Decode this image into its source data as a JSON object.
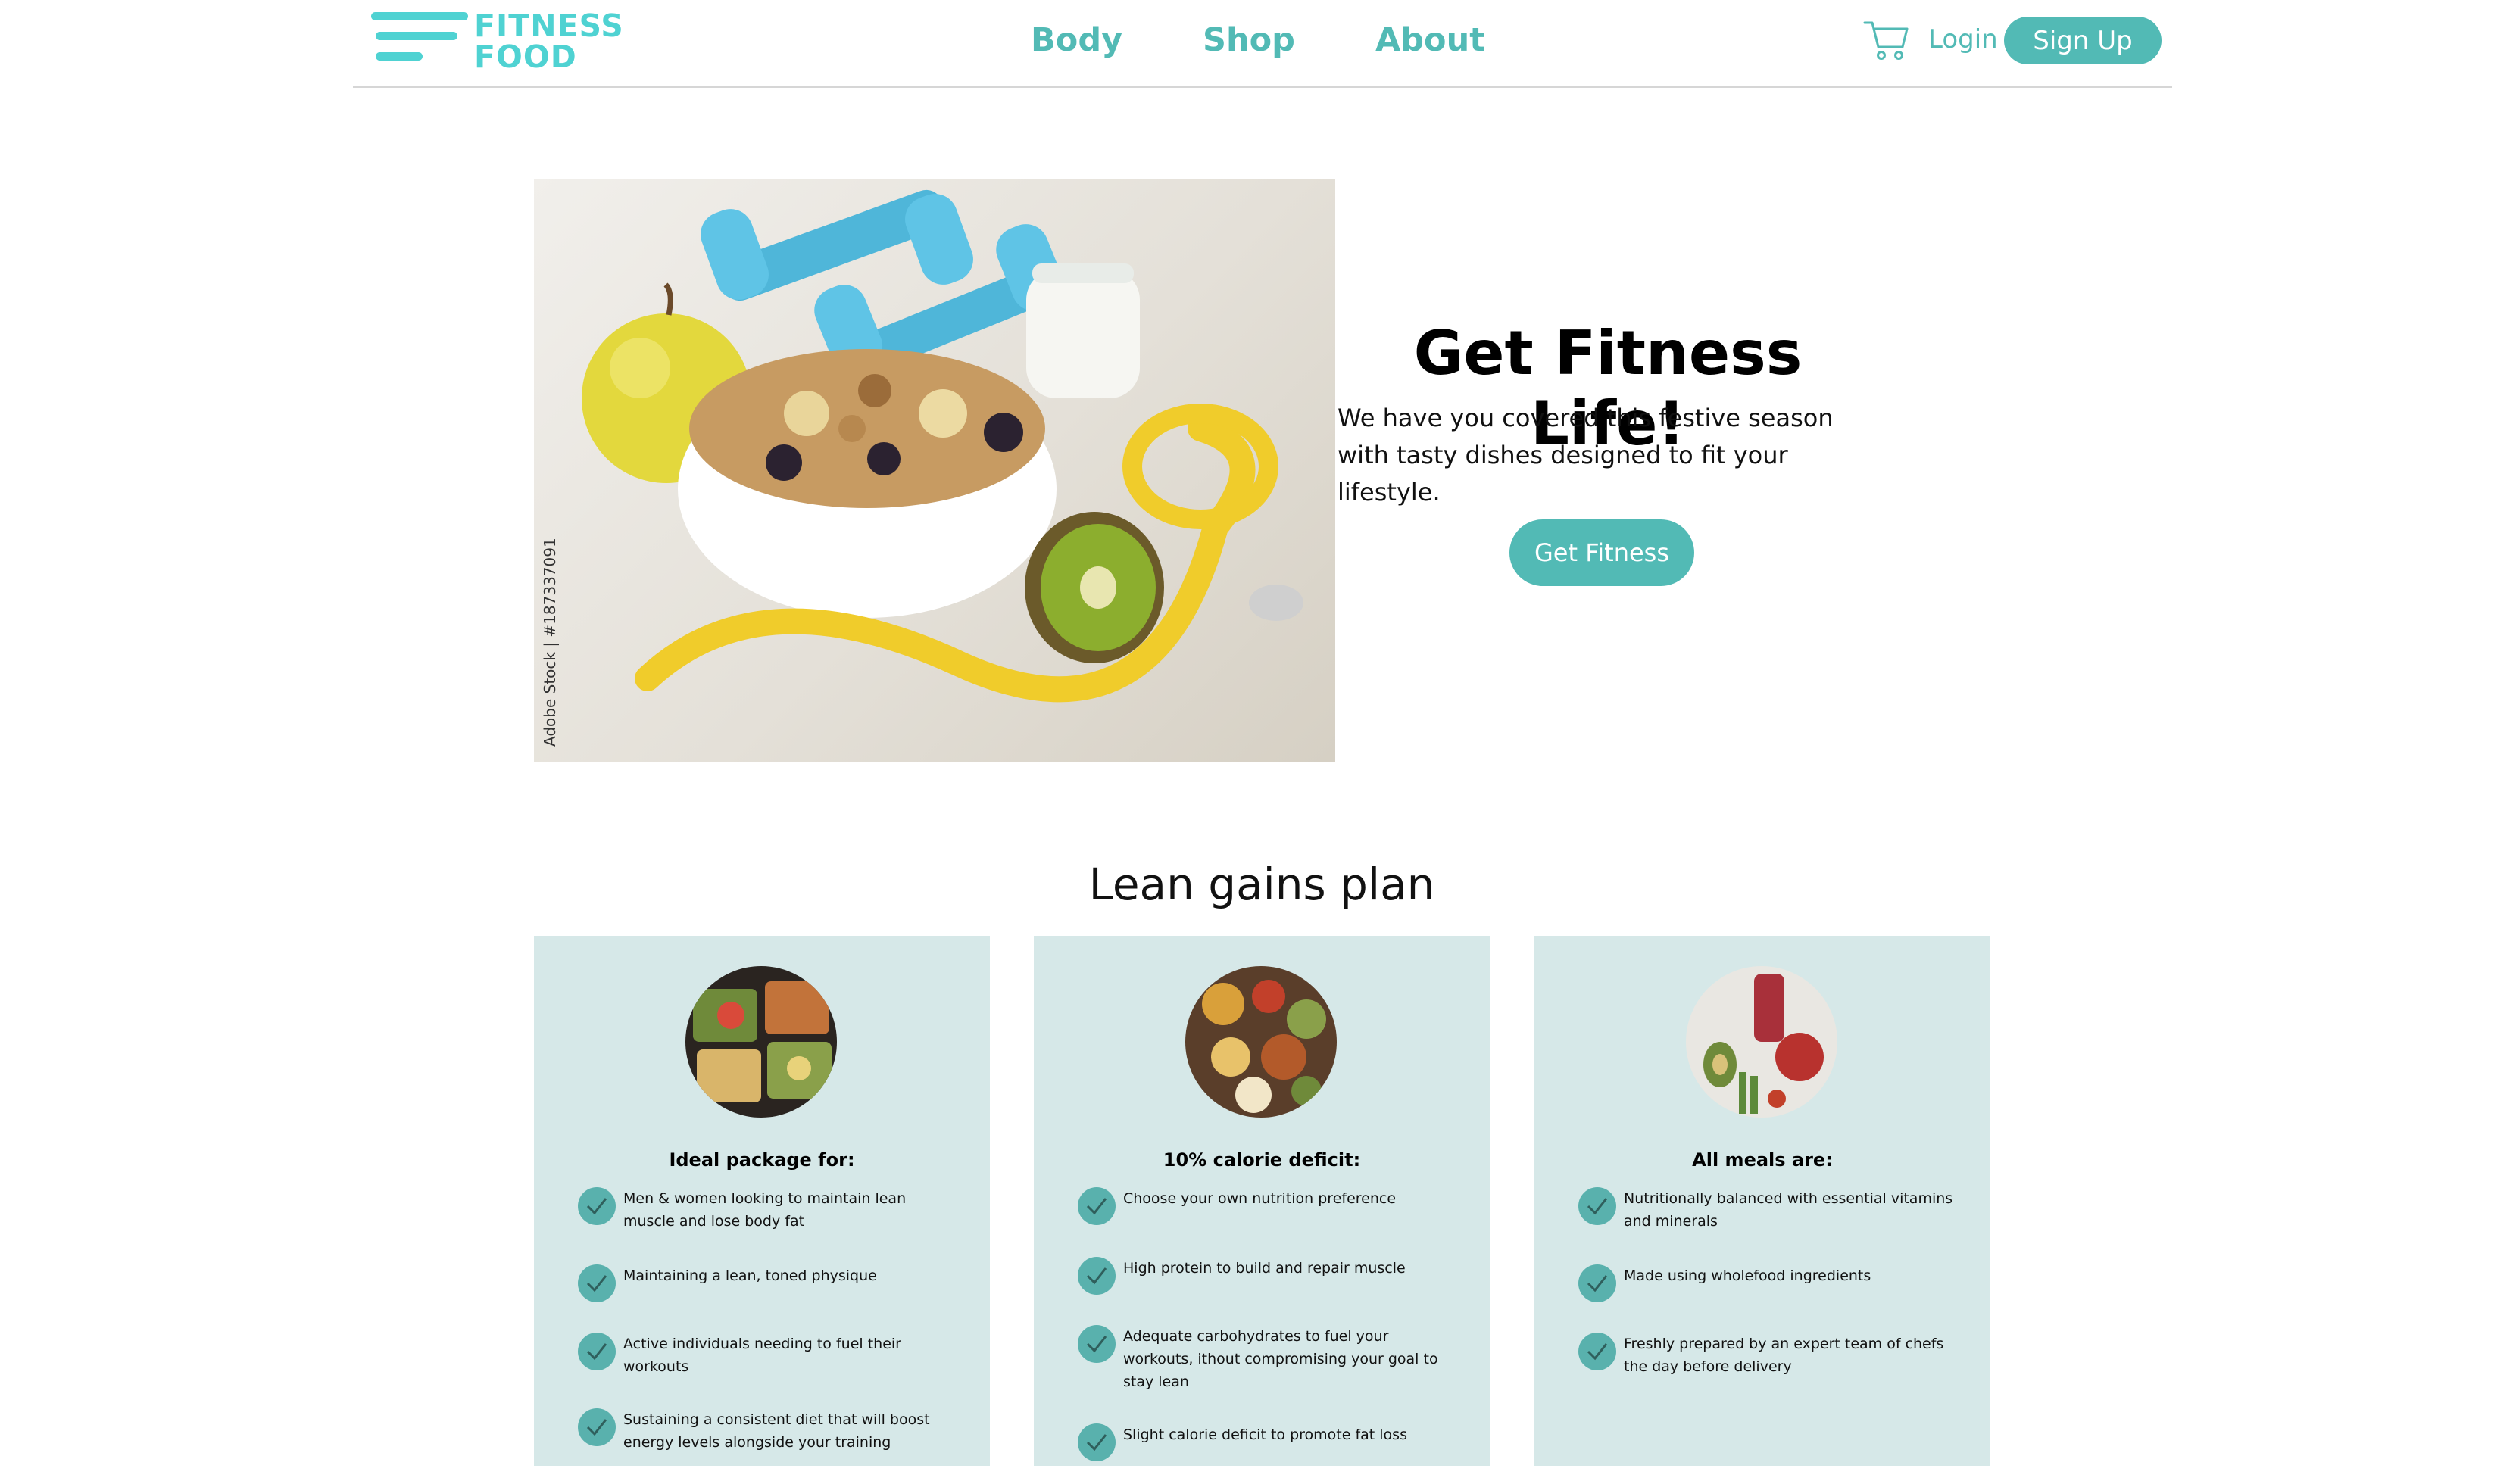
{
  "header": {
    "logo_line1": "FITNESS",
    "logo_line2": "FOOD",
    "nav": [
      "Body",
      "Shop",
      "About"
    ],
    "login_label": "Login",
    "signup_label": "Sign Up",
    "accent_color": "#52bab5",
    "logo_color": "#4fd2d2"
  },
  "hero": {
    "image_watermark": "Adobe Stock | #187337091",
    "title": "Get Fitness Life!",
    "text": "We have you covered this festive season with tasty dishes designed to fit your lifestyle.",
    "button_label": "Get Fitness"
  },
  "plan": {
    "title": "Lean gains plan",
    "card_color": "#d6e8e8",
    "cards": [
      {
        "title": "Ideal package for:",
        "items": [
          "Men & women looking to maintain lean muscle and lose body fat",
          "Maintaining a lean, toned physique",
          "Active individuals needing to fuel their workouts",
          "Sustaining a consistent diet that will boost energy levels alongside your training"
        ]
      },
      {
        "title": "10% calorie deficit:",
        "items": [
          "Choose your own nutrition preference",
          "High protein to build and repair muscle",
          "Adequate carbohydrates to fuel your workouts, ithout compromising your goal to stay lean",
          "Slight calorie deficit to promote fat loss"
        ]
      },
      {
        "title": "All meals are:",
        "items": [
          "Nutritionally balanced with essential vitamins and minerals",
          "Made using wholefood ingredients",
          "Freshly prepared by an expert team of chefs the day before delivery"
        ]
      }
    ]
  }
}
